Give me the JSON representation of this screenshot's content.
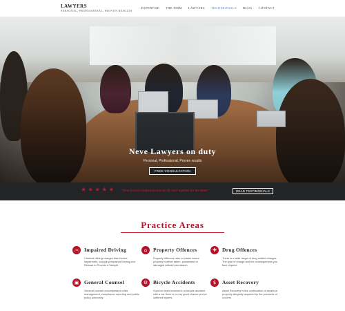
{
  "header": {
    "brand_name": "LAWYERS",
    "brand_tagline": "PERSONAL, PROFESSIONAL, PROVEN RESULTS",
    "nav": [
      {
        "label": "EXPERTISE"
      },
      {
        "label": "THE FIRM"
      },
      {
        "label": "LAWYERS"
      },
      {
        "label": "TESTIMONIALS"
      },
      {
        "label": "BLOG"
      },
      {
        "label": "CONTACT"
      }
    ]
  },
  "hero": {
    "title": "Neve Lawyers on duty",
    "subtitle": "Personal, Professional, Proven results",
    "button": "FREE CONSULTATION"
  },
  "testimonial": {
    "stars": [
      "★",
      "★",
      "★",
      "★",
      "★"
    ],
    "quote": "\"Neve Lawyers helped me put my life back together for the better\"",
    "button": "READ TESTIMONIALS"
  },
  "practice": {
    "title": "Practice Areas",
    "items": [
      {
        "icon": "car-icon",
        "glyph": "🚗",
        "title": "Impaired Driving",
        "desc": "Criminal driving charges that involve impairment, including Impaired Driving and Refusal to Provide a Sample."
      },
      {
        "icon": "home-icon",
        "glyph": "⌂",
        "title": "Property Offences",
        "desc": "Property offences refer to cases where property is either taken, possessed or damaged without permission."
      },
      {
        "icon": "pill-icon",
        "glyph": "✚",
        "title": "Drug Offences",
        "desc": "There is a wide range of drug related charges. The type of charge and the consequences you face depend"
      },
      {
        "icon": "briefcase-icon",
        "glyph": "▣",
        "title": "General Counsel",
        "desc": "General counsel encompasses crisis management, compliance reporting and public policy advocacy."
      },
      {
        "icon": "bicycle-icon",
        "glyph": "⚙",
        "title": "Bicycle Accidents",
        "desc": "If you've been involved in a bicycle accident with a car there is a very good chance you've suffered injuries"
      },
      {
        "icon": "dollar-icon",
        "glyph": "$",
        "title": "Asset Recovery",
        "desc": "Asset Recovery is the confiscation of assets or property allegedly acquired by the proceeds of a crime."
      }
    ]
  }
}
